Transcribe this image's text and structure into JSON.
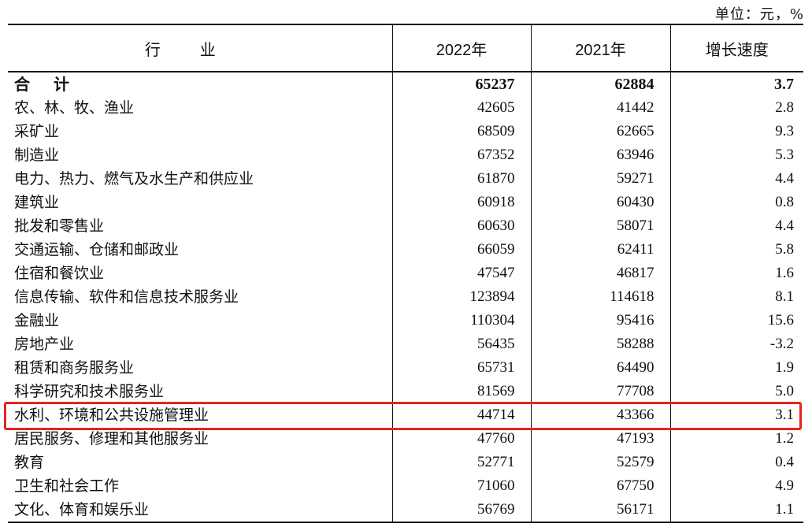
{
  "unit_label": "单位：元，%",
  "header": {
    "industry": "行业",
    "col_2022": "2022年",
    "col_2021": "2021年",
    "col_growth": "增长速度"
  },
  "rows": [
    {
      "name": "合计",
      "v2022": "65237",
      "v2021": "62884",
      "growth": "3.7"
    },
    {
      "name": "农、林、牧、渔业",
      "v2022": "42605",
      "v2021": "41442",
      "growth": "2.8"
    },
    {
      "name": "采矿业",
      "v2022": "68509",
      "v2021": "62665",
      "growth": "9.3"
    },
    {
      "name": "制造业",
      "v2022": "67352",
      "v2021": "63946",
      "growth": "5.3"
    },
    {
      "name": "电力、热力、燃气及水生产和供应业",
      "v2022": "61870",
      "v2021": "59271",
      "growth": "4.4"
    },
    {
      "name": "建筑业",
      "v2022": "60918",
      "v2021": "60430",
      "growth": "0.8"
    },
    {
      "name": "批发和零售业",
      "v2022": "60630",
      "v2021": "58071",
      "growth": "4.4"
    },
    {
      "name": "交通运输、仓储和邮政业",
      "v2022": "66059",
      "v2021": "62411",
      "growth": "5.8"
    },
    {
      "name": "住宿和餐饮业",
      "v2022": "47547",
      "v2021": "46817",
      "growth": "1.6"
    },
    {
      "name": "信息传输、软件和信息技术服务业",
      "v2022": "123894",
      "v2021": "114618",
      "growth": "8.1"
    },
    {
      "name": "金融业",
      "v2022": "110304",
      "v2021": "95416",
      "growth": "15.6"
    },
    {
      "name": "房地产业",
      "v2022": "56435",
      "v2021": "58288",
      "growth": "-3.2"
    },
    {
      "name": "租赁和商务服务业",
      "v2022": "65731",
      "v2021": "64490",
      "growth": "1.9"
    },
    {
      "name": "科学研究和技术服务业",
      "v2022": "81569",
      "v2021": "77708",
      "growth": "5.0"
    },
    {
      "name": "水利、环境和公共设施管理业",
      "v2022": "44714",
      "v2021": "43366",
      "growth": "3.1"
    },
    {
      "name": "居民服务、修理和其他服务业",
      "v2022": "47760",
      "v2021": "47193",
      "growth": "1.2"
    },
    {
      "name": "教育",
      "v2022": "52771",
      "v2021": "52579",
      "growth": "0.4"
    },
    {
      "name": "卫生和社会工作",
      "v2022": "71060",
      "v2021": "67750",
      "growth": "4.9"
    },
    {
      "name": "文化、体育和娱乐业",
      "v2022": "56769",
      "v2021": "56171",
      "growth": "1.1"
    }
  ],
  "highlight": {
    "row_index": 14,
    "color": "#e8231c"
  }
}
